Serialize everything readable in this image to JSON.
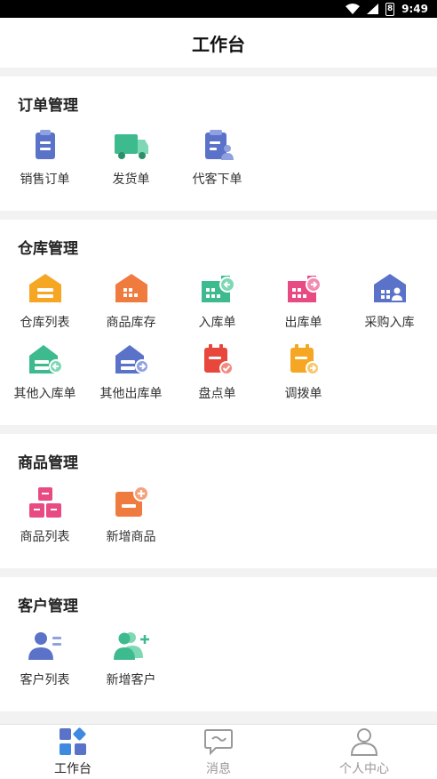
{
  "status": {
    "time": "9:49",
    "battery_level": "8"
  },
  "header": {
    "title": "工作台"
  },
  "sections": [
    {
      "title": "订单管理",
      "items": [
        {
          "label": "销售订单"
        },
        {
          "label": "发货单"
        },
        {
          "label": "代客下单"
        }
      ]
    },
    {
      "title": "仓库管理",
      "items": [
        {
          "label": "仓库列表"
        },
        {
          "label": "商品库存"
        },
        {
          "label": "入库单"
        },
        {
          "label": "出库单"
        },
        {
          "label": "采购入库"
        },
        {
          "label": "其他入库单"
        },
        {
          "label": "其他出库单"
        },
        {
          "label": "盘点单"
        },
        {
          "label": "调拨单"
        }
      ]
    },
    {
      "title": "商品管理",
      "items": [
        {
          "label": "商品列表"
        },
        {
          "label": "新增商品"
        }
      ]
    },
    {
      "title": "客户管理",
      "items": [
        {
          "label": "客户列表"
        },
        {
          "label": "新增客户"
        }
      ]
    }
  ],
  "tabbar": [
    {
      "label": "工作台",
      "active": true
    },
    {
      "label": "消息"
    },
    {
      "label": "个人中心"
    }
  ],
  "colors": {
    "blue": "#5b72c9",
    "green": "#3dbb8e",
    "orange": "#f5a623",
    "red": "#e8473c",
    "pink": "#e84a82",
    "coral": "#f07b3f"
  }
}
